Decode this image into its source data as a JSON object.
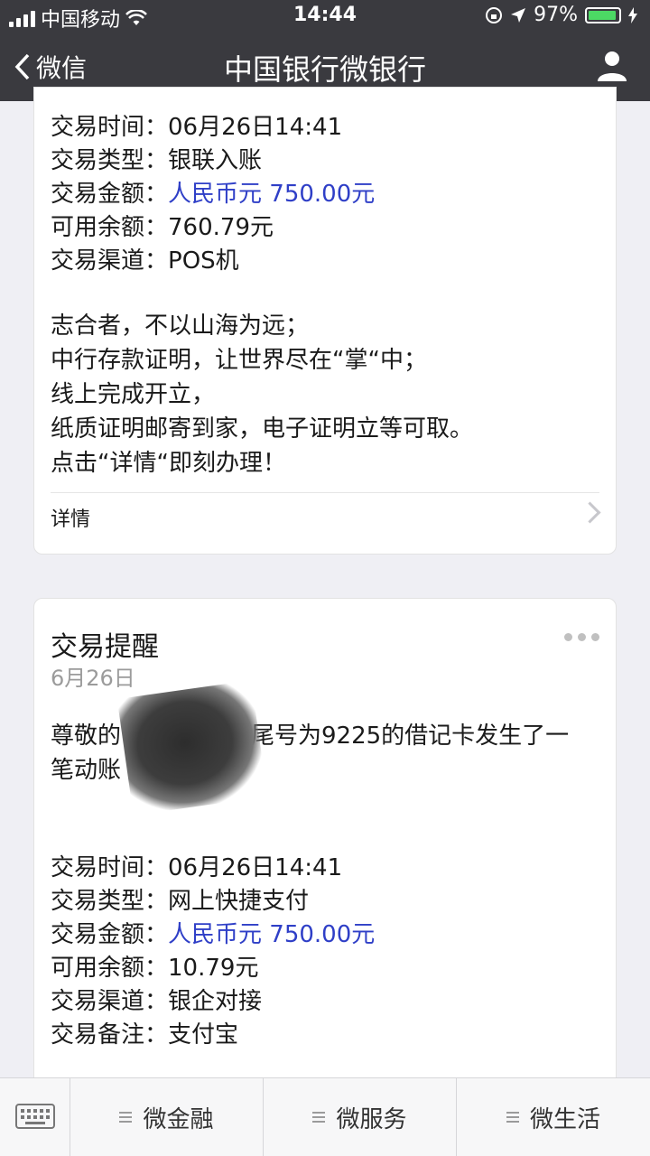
{
  "status": {
    "carrier": "中国移动",
    "time": "14:44",
    "battery": "97%"
  },
  "nav": {
    "back_label": "微信",
    "title": "中国银行微银行"
  },
  "card1": {
    "rows": [
      {
        "label": "交易时间：",
        "value": "06月26日14:41"
      },
      {
        "label": "交易类型：",
        "value": "银联入账"
      },
      {
        "label": "交易金额：",
        "value": "人民币元 750.00元"
      },
      {
        "label": "可用余额：",
        "value": "760.79元"
      },
      {
        "label": "交易渠道：",
        "value": "POS机"
      }
    ],
    "promo": [
      "志合者，不以山海为远；",
      "中行存款证明，让世界尽在“掌“中；",
      "线上完成开立，",
      "纸质证明邮寄到家，电子证明立等可取。",
      "点击“详情“即刻办理！"
    ],
    "details_label": "详情"
  },
  "card2": {
    "title": "交易提醒",
    "date": "6月26日",
    "intro_line1_start": "尊敬的",
    "intro_line1_end": "您尾号为9225的借记卡发生了一",
    "intro_line2": "笔动账",
    "rows": [
      {
        "label": "交易时间：",
        "value": "06月26日14:41"
      },
      {
        "label": "交易类型：",
        "value": "网上快捷支付"
      },
      {
        "label": "交易金额：",
        "value": "人民币元 750.00元"
      },
      {
        "label": "可用余额：",
        "value": "10.79元"
      },
      {
        "label": "交易渠道：",
        "value": "银企对接"
      },
      {
        "label": "交易备注：",
        "value": "支付宝"
      }
    ]
  },
  "bottom": {
    "tabs": [
      "微金融",
      "微服务",
      "微生活"
    ]
  },
  "colors": {
    "amount": "#2f3fc7",
    "bar": "#3a3a3f",
    "battery": "#4cd964"
  }
}
